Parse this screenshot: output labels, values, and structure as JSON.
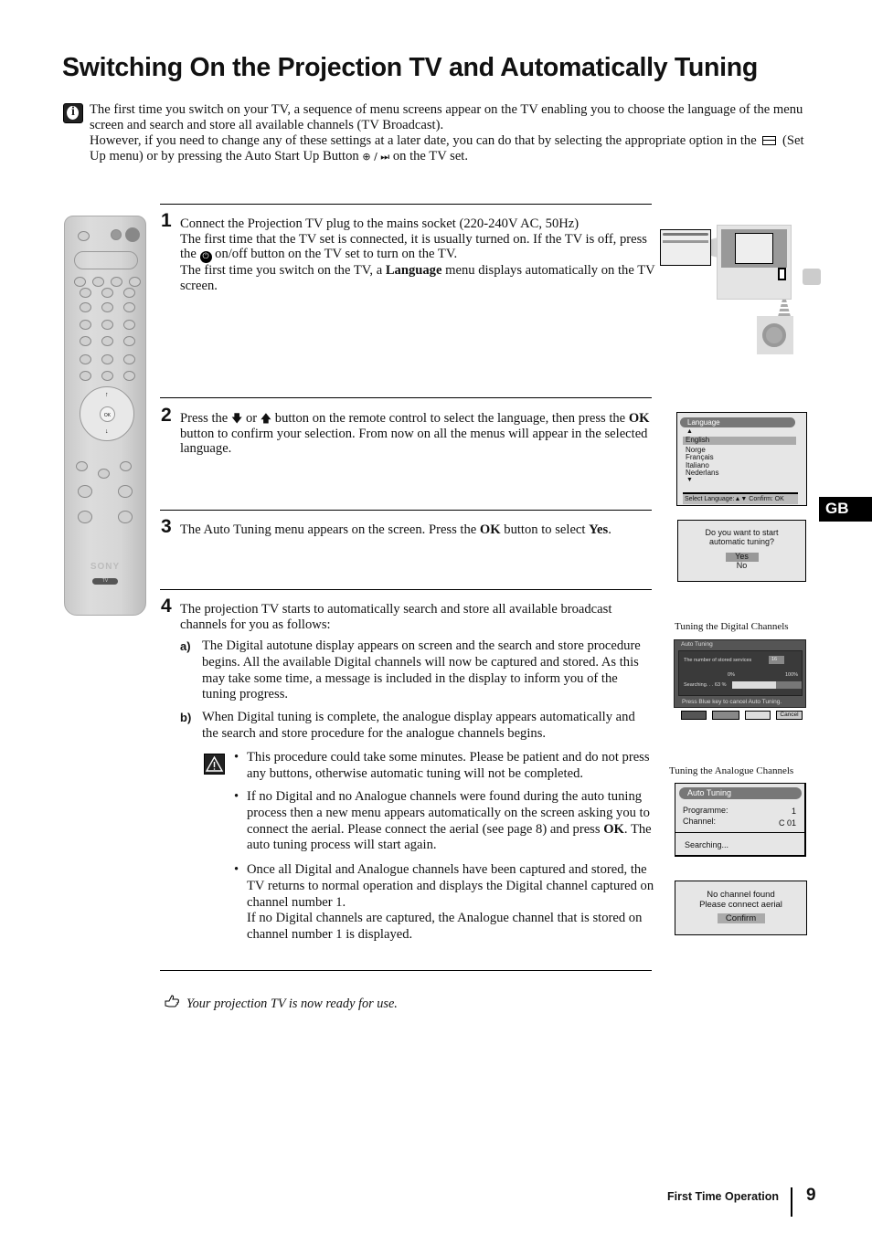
{
  "title": "Switching On the Projection TV and Automatically Tuning",
  "intro": {
    "icon": "info-icon",
    "line1": "The first time you switch on your TV, a sequence of menu screens appear on the TV enabling you to choose the language of the menu screen and search and store all available channels (TV Broadcast).",
    "line2_pre": "However, if you need to change any of these settings at a later date, you can do that by selecting the appropriate option in the",
    "setup_icon": "toolbox-icon",
    "line2_mid": "(Set Up menu) or by pressing the Auto Start Up Button",
    "button_icons": "⊕ / ⏭",
    "line2_post": "on the TV set."
  },
  "steps": [
    {
      "number": "1",
      "text_a": "Connect the Projection TV plug to the mains socket (220-240V AC, 50Hz)",
      "text_b": "The first time that the TV set is connected, it is usually turned on. If the TV is off, press the",
      "power_icon": "power-icon",
      "text_c": "on/off button on the TV set to turn on the TV.",
      "text_d_pre": "The first time you switch on the TV, a",
      "text_d_bold": "Language",
      "text_d_post": "menu displays automatically on the TV screen."
    },
    {
      "number": "2",
      "text_pre": "Press the",
      "text_or": "or",
      "text_mid": "button on the remote control to select the language, then press the",
      "text_bold": "OK",
      "text_post": "button to confirm your selection. From now on all the menus will appear in the selected language."
    },
    {
      "number": "3",
      "text_pre": "The Auto Tuning menu appears on the screen. Press the",
      "text_bold1": "OK",
      "text_mid": "button to select",
      "text_bold2": "Yes",
      "text_post": "."
    },
    {
      "number": "4",
      "text": "The projection TV starts to automatically search and store all available broadcast channels for you as follows:",
      "a_label": "a)",
      "a_text": "The Digital autotune display appears on screen and the search and store procedure begins. All the available Digital channels will now be captured and stored. As this may take some time, a message is included in the display to inform you of the tuning progress.",
      "b_label": "b)",
      "b_text": "When Digital tuning is complete, the analogue display appears automatically and the search and store procedure for the analogue channels begins.",
      "bullets": [
        {
          "text": "This procedure could take some minutes. Please be patient and do not press any buttons, otherwise automatic tuning will not be completed."
        },
        {
          "pre": "If no Digital and no Analogue channels were found during the auto tuning process then a new menu appears automatically on the screen asking you to connect the aerial. Please connect the aerial (see page 8) and press",
          "bold": "OK",
          "post": ". The auto tuning process will start again."
        },
        {
          "text1": "Once all Digital and Analogue channels have been captured and stored, the TV returns to normal operation and displays the Digital channel captured on channel number 1.",
          "text2": "If no Digital channels are captured, the Analogue channel that is stored on channel number 1 is displayed."
        }
      ]
    }
  ],
  "footer_note": "Your projection TV is now ready for use.",
  "language_menu": {
    "title": "Language",
    "items": [
      "English",
      "Norge",
      "Français",
      "Italiano",
      "Nederlans"
    ],
    "selected": "English",
    "footer": "Select Language:▲▼  Confirm: OK"
  },
  "auto_tune_prompt": {
    "question_1": "Do you want to start",
    "question_2": "automatic tuning?",
    "yes": "Yes",
    "no": "No"
  },
  "digital_tuning": {
    "caption": "Tuning the Digital Channels",
    "title": "Auto Tuning",
    "stored_label": "The number of stored services",
    "stored_value": "16",
    "min_label": "0%",
    "max_label": "100%",
    "searching": "Searching. . . 63 %",
    "progress": 0.63,
    "hint": "Press Blue key to cancel Auto Tuning.",
    "cancel": "Cancel"
  },
  "analogue_tuning": {
    "caption": "Tuning the Analogue Channels",
    "title": "Auto Tuning",
    "programme_label": "Programme:",
    "programme_value": "1",
    "channel_label": "Channel:",
    "channel_value": "C 01",
    "status": "Searching..."
  },
  "no_channel": {
    "line1": "No channel found",
    "line2": "Please connect aerial",
    "button": "Confirm"
  },
  "remote": {
    "brand": "SONY",
    "mode": "TV",
    "ok": "OK"
  },
  "side_tab": "GB",
  "page_footer": {
    "section": "First Time Operation",
    "page": "9"
  }
}
